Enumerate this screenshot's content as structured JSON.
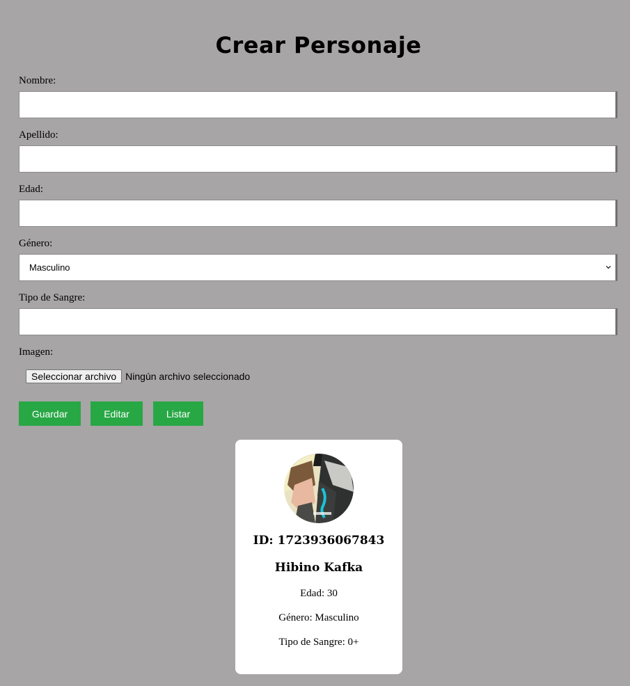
{
  "page": {
    "title": "Crear Personaje"
  },
  "form": {
    "nombre_label": "Nombre:",
    "nombre_value": "",
    "apellido_label": "Apellido:",
    "apellido_value": "",
    "edad_label": "Edad:",
    "edad_value": "",
    "genero_label": "Género:",
    "genero_selected": "Masculino",
    "sangre_label": "Tipo de Sangre:",
    "sangre_value": "",
    "imagen_label": "Imagen:",
    "file_button": "Seleccionar archivo",
    "file_status": "Ningún archivo seleccionado"
  },
  "actions": {
    "guardar": "Guardar",
    "editar": "Editar",
    "listar": "Listar",
    "accent_color": "#28a745"
  },
  "card": {
    "id_text": "ID: 1723936067843",
    "name": "Hibino Kafka",
    "edad": "Edad: 30",
    "genero": "Género: Masculino",
    "sangre": "Tipo de Sangre: 0+",
    "avatar_icon": "character-avatar-image"
  }
}
